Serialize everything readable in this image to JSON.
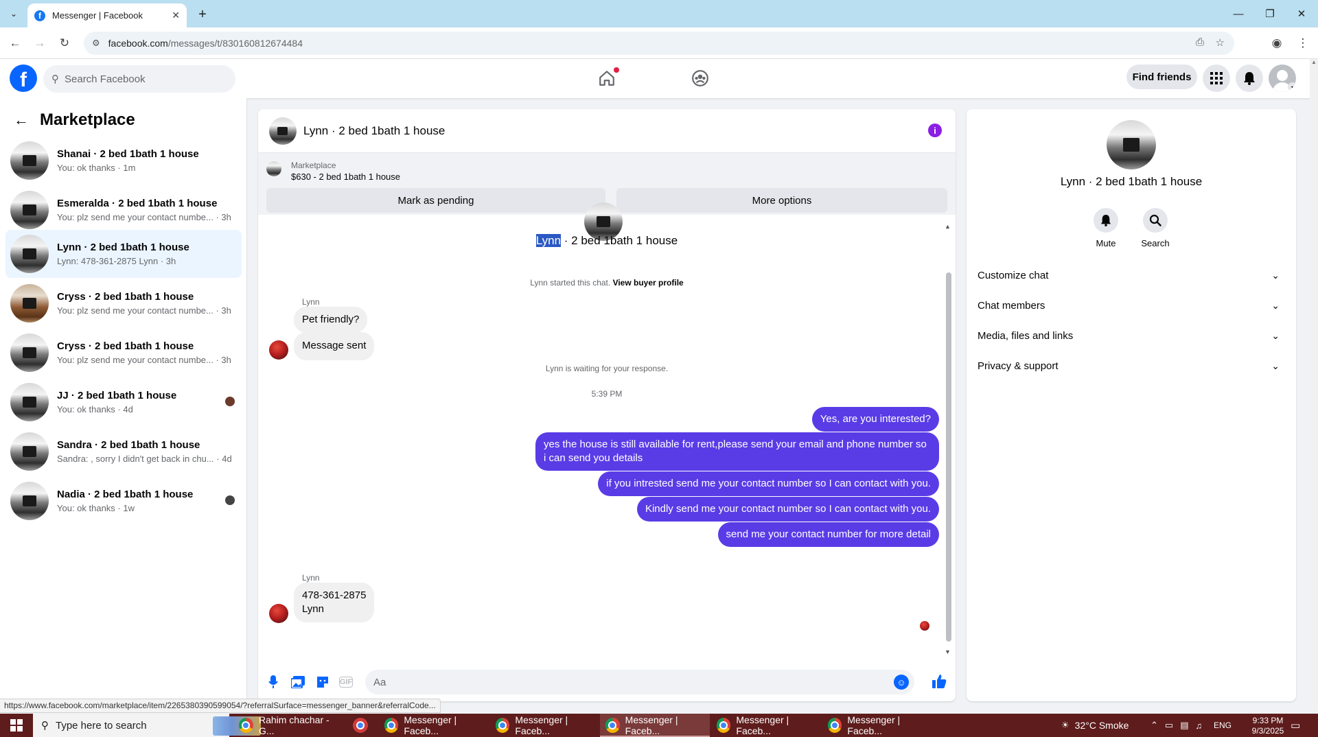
{
  "browser": {
    "tab_title": "Messenger | Facebook",
    "url_domain": "facebook.com",
    "url_path": "/messages/t/830160812674484"
  },
  "fb": {
    "search_placeholder": "Search Facebook",
    "find_friends": "Find friends"
  },
  "left": {
    "title": "Marketplace",
    "conversations": [
      {
        "name": "Shanai · 2 bed 1bath 1 house",
        "preview": "You: ok thanks · 1m"
      },
      {
        "name": "Esmeralda · 2 bed 1bath 1 house",
        "preview": "You: plz send me your contact numbe... · 3h"
      },
      {
        "name": "Lynn · 2 bed 1bath 1 house",
        "preview": "Lynn: 478-361-2875 Lynn · 3h"
      },
      {
        "name": "Cryss · 2 bed 1bath 1 house",
        "preview": "You: plz send me your contact numbe... · 3h"
      },
      {
        "name": "Cryss · 2 bed 1bath 1 house",
        "preview": "You: plz send me your contact numbe... · 3h"
      },
      {
        "name": "JJ · 2 bed 1bath 1 house",
        "preview": "You: ok thanks · 4d"
      },
      {
        "name": "Sandra · 2 bed 1bath 1 house",
        "preview": "Sandra: , sorry I didn't get back in chu... · 4d"
      },
      {
        "name": "Nadia · 2 bed 1bath 1 house",
        "preview": "You: ok thanks · 1w"
      }
    ]
  },
  "chat": {
    "header_name": "Lynn · 2 bed 1bath 1 house",
    "banner_label": "Marketplace",
    "banner_price": "$630 - 2 bed 1bath 1 house",
    "mark_pending": "Mark as pending",
    "more_options": "More options",
    "title_highlight": "Lynn",
    "title_rest": " · 2 bed 1bath 1 house",
    "started_text": "Lynn started this chat.",
    "view_profile": "View buyer profile",
    "sender_name": "Lynn",
    "msg_in_1": "Pet friendly?",
    "msg_in_2": "Message sent",
    "waiting_text": "Lynn is waiting for your response.",
    "timestamp": "5:39 PM",
    "out_1": "Yes, are you interested?",
    "out_2": "yes the house is still available for rent,please send your email and phone number so i can send you details",
    "out_3": "if you intrested send me your contact number so I can contact with you.",
    "out_4": "Kindly send me your contact number so I can contact with you.",
    "out_5": "send me your contact number for more detail",
    "sender_name_2": "Lynn",
    "msg_in_3": "478-361-2875\nLynn",
    "composer_placeholder": "Aa",
    "gif_label": "GIF"
  },
  "right": {
    "name": "Lynn · 2 bed 1bath 1 house",
    "mute": "Mute",
    "search": "Search",
    "rows": [
      "Customize chat",
      "Chat members",
      "Media, files and links",
      "Privacy & support"
    ]
  },
  "status_url": "https://www.facebook.com/marketplace/item/2265380390599054/?referralSurface=messenger_banner&referralCode...",
  "taskbar": {
    "search_placeholder": "Type here to search",
    "apps": [
      "Rahim chachar - G...",
      "Messenger | Faceb...",
      "Messenger | Faceb...",
      "Messenger | Faceb...",
      "Messenger | Faceb...",
      "Messenger | Faceb..."
    ],
    "weather": "32°C  Smoke",
    "lang": "ENG",
    "time": "9:33 PM",
    "date": "9/3/2025"
  },
  "colors": {
    "brand": "#0866ff",
    "outgoing_bubble": "#5a3ce6",
    "taskbar": "#5e1c1c",
    "tabbar": "#b9dff0"
  }
}
